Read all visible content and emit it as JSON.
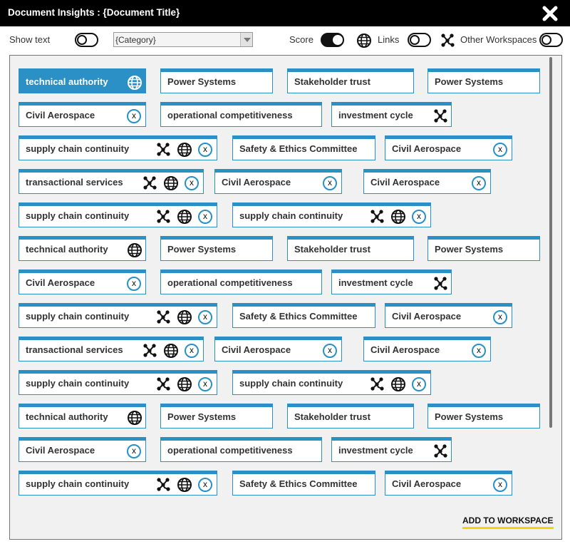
{
  "window": {
    "title": "Document Insights : {Document Title}"
  },
  "toolbar": {
    "show_text_label": "Show text",
    "show_text_on": false,
    "category_value": "{Category}",
    "score_label": "Score",
    "score_on": true,
    "links_label": "Links",
    "links_on": false,
    "other_workspaces_label": "Other Workspaces",
    "other_workspaces_on": false
  },
  "tags": [
    {
      "label": "technical authority",
      "selected": true,
      "icons": [
        "globe"
      ]
    },
    {
      "label": "Power Systems",
      "icons": []
    },
    {
      "label": "Stakeholder trust",
      "icons": []
    },
    {
      "label": "Power Systems",
      "icons": []
    },
    {
      "label": "Civil Aerospace",
      "icons": [
        "remove"
      ]
    },
    {
      "label": "operational competitiveness",
      "icons": []
    },
    {
      "label": "investment cycle",
      "icons": [
        "network"
      ]
    },
    {
      "label": "supply chain continuity",
      "icons": [
        "network",
        "globe",
        "remove"
      ]
    },
    {
      "label": "Safety & Ethics Committee",
      "icons": []
    },
    {
      "label": "Civil Aerospace",
      "icons": [
        "remove"
      ]
    },
    {
      "label": "transactional services",
      "icons": [
        "network",
        "globe",
        "remove"
      ]
    },
    {
      "label": "Civil Aerospace",
      "icons": [
        "remove"
      ]
    },
    {
      "label": "Civil Aerospace",
      "icons": [
        "remove"
      ]
    },
    {
      "label": "supply chain continuity",
      "icons": [
        "network",
        "globe",
        "remove"
      ]
    },
    {
      "label": "supply chain continuity",
      "icons": [
        "network",
        "globe",
        "remove"
      ]
    },
    {
      "label": "technical authority",
      "icons": [
        "globe"
      ]
    },
    {
      "label": "Power Systems",
      "icons": []
    },
    {
      "label": "Stakeholder trust",
      "icons": []
    },
    {
      "label": "Power Systems",
      "icons": []
    },
    {
      "label": "Civil Aerospace",
      "icons": [
        "remove"
      ]
    },
    {
      "label": "operational competitiveness",
      "icons": []
    },
    {
      "label": "investment cycle",
      "icons": [
        "network"
      ]
    },
    {
      "label": "supply chain continuity",
      "icons": [
        "network",
        "globe",
        "remove"
      ]
    },
    {
      "label": "Safety & Ethics Committee",
      "icons": []
    },
    {
      "label": "Civil Aerospace",
      "icons": [
        "remove"
      ]
    },
    {
      "label": "transactional services",
      "icons": [
        "network",
        "globe",
        "remove"
      ]
    },
    {
      "label": "Civil Aerospace",
      "icons": [
        "remove"
      ]
    },
    {
      "label": "Civil Aerospace",
      "icons": [
        "remove"
      ]
    },
    {
      "label": "supply chain continuity",
      "icons": [
        "network",
        "globe",
        "remove"
      ]
    },
    {
      "label": "supply chain continuity",
      "icons": [
        "network",
        "globe",
        "remove"
      ]
    },
    {
      "label": "technical authority",
      "icons": [
        "globe"
      ]
    },
    {
      "label": "Power Systems",
      "icons": []
    },
    {
      "label": "Stakeholder trust",
      "icons": []
    },
    {
      "label": "Power Systems",
      "icons": []
    },
    {
      "label": "Civil Aerospace",
      "icons": [
        "remove"
      ]
    },
    {
      "label": "operational competitiveness",
      "icons": []
    },
    {
      "label": "investment cycle",
      "icons": [
        "network"
      ]
    },
    {
      "label": "supply chain continuity",
      "icons": [
        "network",
        "globe",
        "remove"
      ]
    },
    {
      "label": "Safety & Ethics Committee",
      "icons": []
    },
    {
      "label": "Civil Aerospace",
      "icons": [
        "remove"
      ]
    }
  ],
  "remove_glyph": "x",
  "footer": {
    "add_label": "ADD TO WORKSPACE"
  },
  "colors": {
    "accent": "#2a90c6",
    "underline": "#f2d600",
    "titlebar": "#000000"
  }
}
